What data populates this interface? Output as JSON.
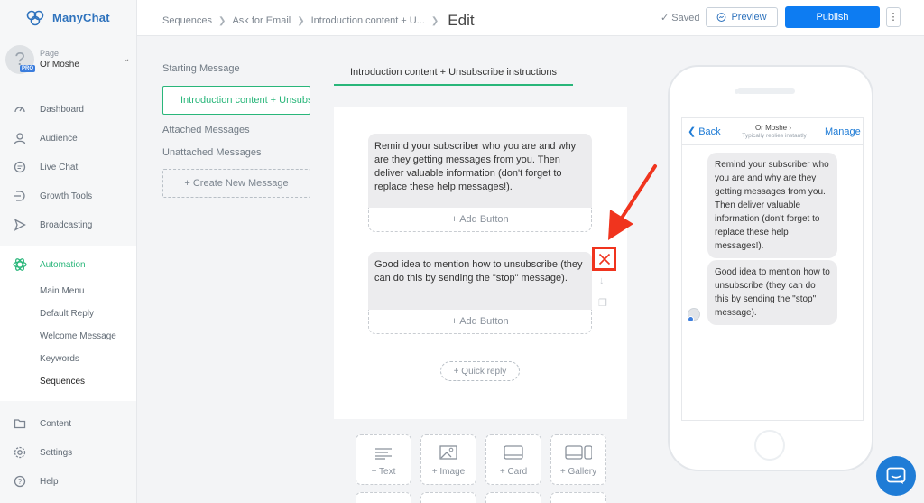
{
  "app": {
    "name": "ManyChat"
  },
  "page_selector": {
    "label": "Page",
    "name": "Or Moshe",
    "badge": "PRO"
  },
  "nav": {
    "dashboard": "Dashboard",
    "audience": "Audience",
    "live_chat": "Live Chat",
    "growth_tools": "Growth Tools",
    "broadcasting": "Broadcasting",
    "automation": "Automation",
    "sub": {
      "main_menu": "Main Menu",
      "default_reply": "Default Reply",
      "welcome_message": "Welcome Message",
      "keywords": "Keywords",
      "sequences": "Sequences"
    },
    "content": "Content",
    "settings": "Settings",
    "help": "Help"
  },
  "breadcrumb": {
    "items": [
      "Sequences",
      "Ask for Email",
      "Introduction content + U..."
    ],
    "current": "Edit"
  },
  "toolbar": {
    "saved": "Saved",
    "preview": "Preview",
    "publish": "Publish"
  },
  "messages_panel": {
    "starting_title": "Starting Message",
    "starting_item": "Introduction content + Unsubscribe instructions",
    "attached_title": "Attached Messages",
    "unattached_title": "Unattached Messages",
    "create_new": "+ Create New Message"
  },
  "editor": {
    "tab_title": "Introduction content + Unsubscribe instructions",
    "block1_text": "Remind your subscriber who you are and why are they getting messages from you. Then deliver valuable information (don't forget to replace these help messages!).",
    "block1_add_button": "+ Add Button",
    "block2_text": "Good idea to mention how to unsubscribe (they can do this by sending the \"stop\" message).",
    "block2_add_button": "+ Add Button",
    "quick_reply": "+ Quick reply"
  },
  "tiles": {
    "text": "+ Text",
    "image": "+ Image",
    "card": "+ Card",
    "gallery": "+ Gallery"
  },
  "preview_phone": {
    "back": "Back",
    "contact": "Or Moshe",
    "status": "Typically replies instantly",
    "manage": "Manage",
    "bubble1": "Remind your subscriber who you are and why are they getting messages from you. Then deliver valuable information (don't forget to replace these help messages!).",
    "bubble2": "Good idea to mention how to unsubscribe (they can do this by sending the \"stop\" message)."
  },
  "colors": {
    "brand": "#2f73bd",
    "accent_green": "#29b67a",
    "publish_blue": "#0d7cf2",
    "annotation_red": "#f0341e"
  }
}
